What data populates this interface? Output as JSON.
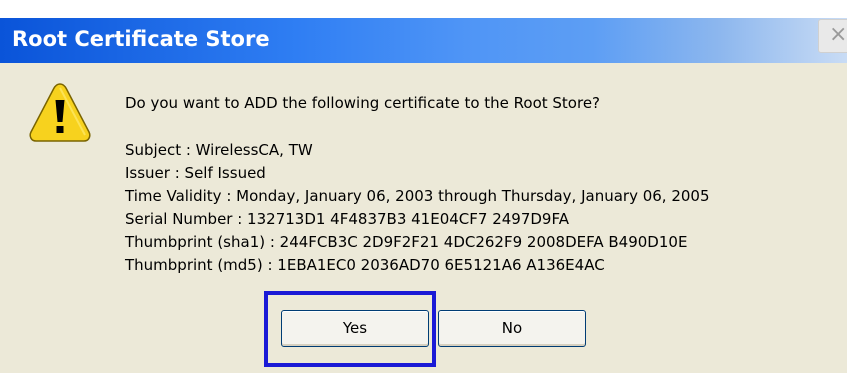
{
  "window": {
    "title": "Root Certificate Store",
    "close_glyph": "×"
  },
  "message": {
    "question": "Do you want to ADD the following certificate to the Root Store?",
    "subject": "Subject : WirelessCA, TW",
    "issuer": "Issuer : Self Issued",
    "validity": "Time Validity : Monday, January 06, 2003 through Thursday, January 06, 2005",
    "serial": "Serial Number : 132713D1 4F4837B3 41E04CF7 2497D9FA",
    "sha1": "Thumbprint (sha1) : 244FCB3C 2D9F2F21 4DC262F9 2008DEFA B490D10E",
    "md5": "Thumbprint (md5) : 1EBA1EC0 2036AD70 6E5121A6 A136E4AC"
  },
  "buttons": {
    "yes": "Yes",
    "no": "No"
  },
  "icons": {
    "warning": "warning-icon",
    "close": "close-icon"
  },
  "colors": {
    "title_bar": "#0a54d9",
    "dialog_bg": "#ece9d8",
    "highlight": "#1a1ad6",
    "warning_fill": "#f7d21e"
  }
}
